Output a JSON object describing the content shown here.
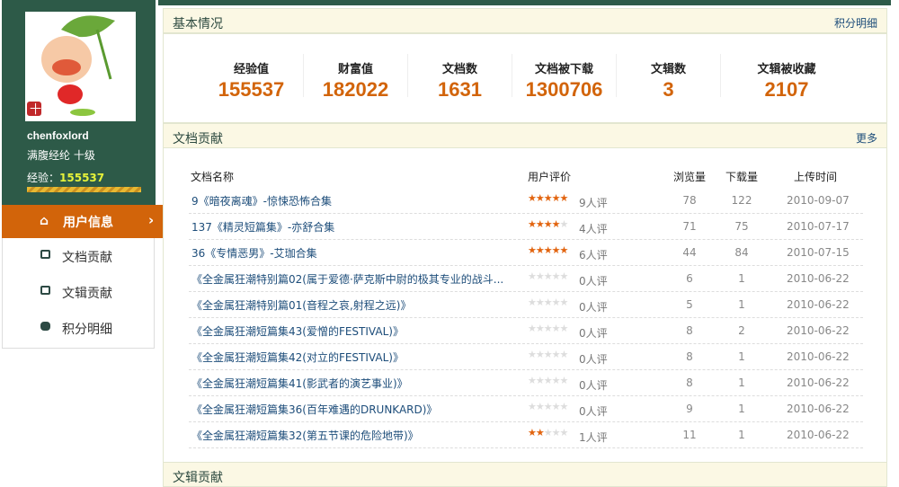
{
  "user": {
    "name": "chenfoxlord",
    "level": "满腹经纶 十级",
    "exp_label": "经验：",
    "exp_value": "155537",
    "exp_progress": 1.0
  },
  "nav": {
    "active": "用户信息",
    "items": [
      "文档贡献",
      "文辑贡献",
      "积分明细"
    ]
  },
  "basic": {
    "title": "基本情况",
    "link": "积分明细",
    "stats": [
      {
        "label": "经验值",
        "value": "155537"
      },
      {
        "label": "财富值",
        "value": "182022"
      },
      {
        "label": "文档数",
        "value": "1631"
      },
      {
        "label": "文档被下载",
        "value": "1300706"
      },
      {
        "label": "文辑数",
        "value": "3"
      },
      {
        "label": "文辑被收藏",
        "value": "2107"
      }
    ]
  },
  "docs": {
    "title": "文档贡献",
    "more": "更多",
    "headers": [
      "文档名称",
      "用户评价",
      "浏览量",
      "下载量",
      "上传时间"
    ],
    "rows": [
      {
        "name": "9《暗夜离魂》-惊悚恐怖合集",
        "rating": 4.5,
        "count": "9人评",
        "views": "78",
        "downloads": "122",
        "date": "2010-09-07"
      },
      {
        "name": "137《精灵短篇集》-亦舒合集",
        "rating": 3.5,
        "count": "4人评",
        "views": "71",
        "downloads": "75",
        "date": "2010-07-17"
      },
      {
        "name": "36《专情恶男》-艾珈合集",
        "rating": 5,
        "count": "6人评",
        "views": "44",
        "downloads": "84",
        "date": "2010-07-15"
      },
      {
        "name": "《全金属狂潮特别篇02(属于爱德·萨克斯中尉的极其专业的战斗...",
        "rating": 0,
        "count": "0人评",
        "views": "6",
        "downloads": "1",
        "date": "2010-06-22"
      },
      {
        "name": "《全金属狂潮特别篇01(音程之哀,射程之远)》",
        "rating": 0,
        "count": "0人评",
        "views": "5",
        "downloads": "1",
        "date": "2010-06-22"
      },
      {
        "name": "《全金属狂潮短篇集43(爱憎的FESTIVAL)》",
        "rating": 0,
        "count": "0人评",
        "views": "8",
        "downloads": "2",
        "date": "2010-06-22"
      },
      {
        "name": "《全金属狂潮短篇集42(对立的FESTIVAL)》",
        "rating": 0,
        "count": "0人评",
        "views": "8",
        "downloads": "1",
        "date": "2010-06-22"
      },
      {
        "name": "《全金属狂潮短篇集41(影武者的演艺事业)》",
        "rating": 0,
        "count": "0人评",
        "views": "8",
        "downloads": "1",
        "date": "2010-06-22"
      },
      {
        "name": "《全金属狂潮短篇集36(百年难遇的DRUNKARD)》",
        "rating": 0,
        "count": "0人评",
        "views": "9",
        "downloads": "1",
        "date": "2010-06-22"
      },
      {
        "name": "《全金属狂潮短篇集32(第五节课的危险地带)》",
        "rating": 2,
        "count": "1人评",
        "views": "11",
        "downloads": "1",
        "date": "2010-06-22"
      }
    ]
  },
  "albums": {
    "title": "文辑贡献"
  }
}
